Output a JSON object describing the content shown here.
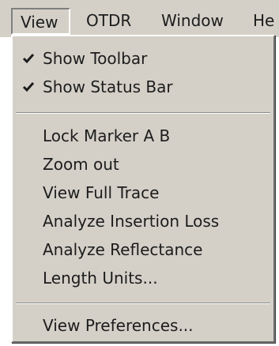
{
  "menubar": {
    "items": [
      {
        "label": "View"
      },
      {
        "label": "OTDR"
      },
      {
        "label": "Window"
      },
      {
        "label": "He"
      }
    ]
  },
  "view_menu": {
    "show_toolbar": {
      "label": "Show Toolbar",
      "checked": true,
      "icon": "checkmark-icon"
    },
    "show_status_bar": {
      "label": "Show Status Bar",
      "checked": true,
      "icon": "checkmark-icon"
    },
    "lock_marker": {
      "label": "Lock Marker A B"
    },
    "zoom_out": {
      "label": "Zoom out"
    },
    "view_full_trace": {
      "label": "View Full Trace"
    },
    "analyze_insertion_loss": {
      "label": "Analyze Insertion Loss"
    },
    "analyze_reflectance": {
      "label": "Analyze Reflectance"
    },
    "length_units": {
      "label": "Length Units..."
    },
    "view_preferences": {
      "label": "View Preferences..."
    }
  },
  "colors": {
    "menu_background": "#d4d0c8",
    "text": "#1c1c1c"
  }
}
